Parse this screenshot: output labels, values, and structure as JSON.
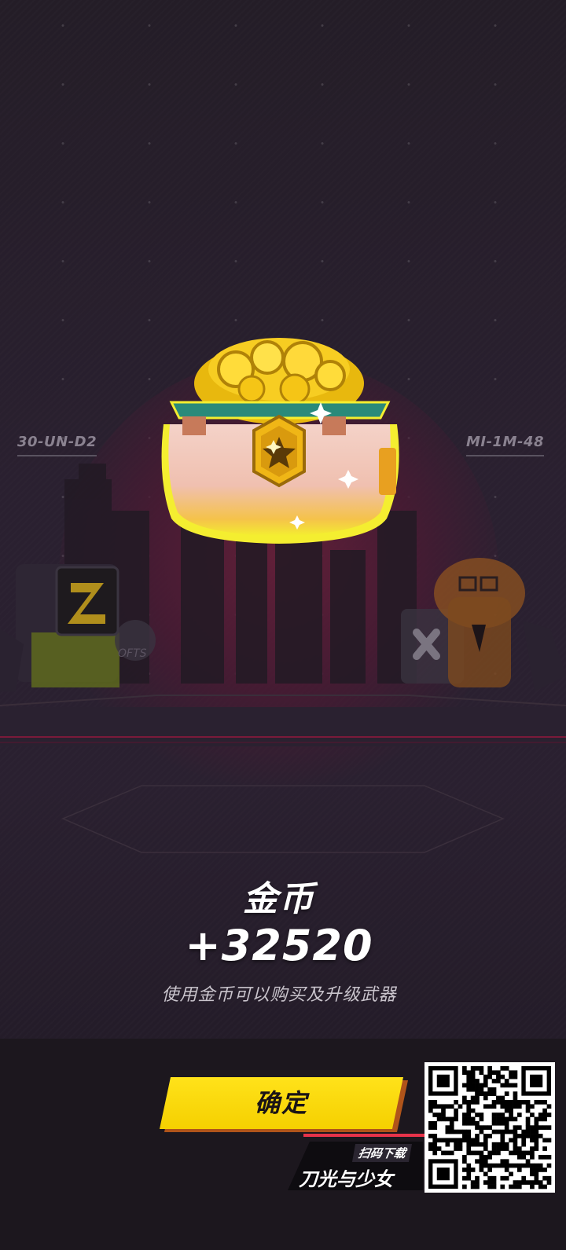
{
  "scene": {
    "left_code": "30-UN-D2",
    "right_code": "MI-1M-48",
    "reward_icon": "coin-pot-icon"
  },
  "reward": {
    "title": "金币",
    "amount": "+32520",
    "description": "使用金币可以购买及升级武器"
  },
  "actions": {
    "confirm_label": "确定"
  },
  "promo": {
    "scan_label": "扫码下载",
    "game_name": "刀光与少女",
    "qr_icon": "qr-code-icon"
  },
  "colors": {
    "button_yellow": "#f5d000",
    "accent_red": "#e6334a",
    "background": "#241d27",
    "coin_gold": "#f7c21a"
  }
}
